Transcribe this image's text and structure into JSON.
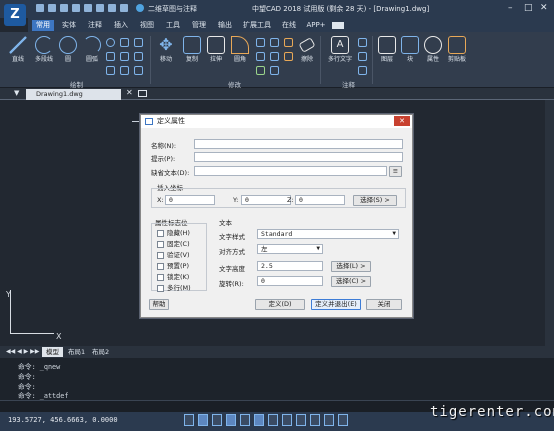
{
  "app": {
    "workspace": "二维草图与注释",
    "title": "中望CAD 2018 试用版 (剩余 28 天) - [Drawing1.dwg]"
  },
  "menu": [
    "常用",
    "实体",
    "注释",
    "插入",
    "视图",
    "工具",
    "管理",
    "输出",
    "扩展工具",
    "在线",
    "APP+"
  ],
  "ribbon": {
    "draw": {
      "group": "绘制",
      "line": "直线",
      "polyline": "多段线",
      "circle": "圆",
      "arc": "圆弧"
    },
    "modify": {
      "group": "修改",
      "move": "移动",
      "copy": "复制",
      "stretch": "拉伸",
      "fillet": "圆角",
      "erase": "擦除"
    },
    "annot": {
      "group": "注释",
      "mtext": "多行文字"
    },
    "layer": "图层",
    "block": "块",
    "props": "属性",
    "clipboard": "剪贴板"
  },
  "doc": {
    "tab": "Drawing1.dwg"
  },
  "dialog": {
    "title": "定义属性",
    "name_label": "名称(N):",
    "prompt_label": "提示(P):",
    "default_label": "缺省文本(D):",
    "insert_group": "插入坐标",
    "x_label": "X:",
    "x": "0",
    "y_label": "Y:",
    "y": "0",
    "z_label": "Z:",
    "z": "0",
    "pick_btn": "选择(S) >",
    "flags_group": "属性标志位",
    "flags": [
      "隐藏(H)",
      "固定(C)",
      "验证(V)",
      "预置(P)",
      "锁定(K)",
      "多行(M)"
    ],
    "text_group": "文本",
    "style_label": "文字样式",
    "style": "Standard",
    "justify_label": "对齐方式",
    "justify": "左",
    "height_label": "文字高度",
    "height": "2.5",
    "height_btn": "选择(L) >",
    "rotation_label": "旋转(R):",
    "rotation": "0",
    "rotation_btn": "选择(C) >",
    "help": "帮助",
    "define": "定义(D)",
    "define_exit": "定义并退出(E)",
    "close": "关闭"
  },
  "layouts": [
    "模型",
    "布局1",
    "布局2"
  ],
  "command": [
    "命令: _qnew",
    "命令:",
    "命令:",
    "命令: _attdef"
  ],
  "status": {
    "coords": "193.5727, 456.6663, 0.0000"
  },
  "watermark": "tigerenter.com",
  "colors": {
    "accent": "#3d76c2",
    "bg": "#222831"
  }
}
